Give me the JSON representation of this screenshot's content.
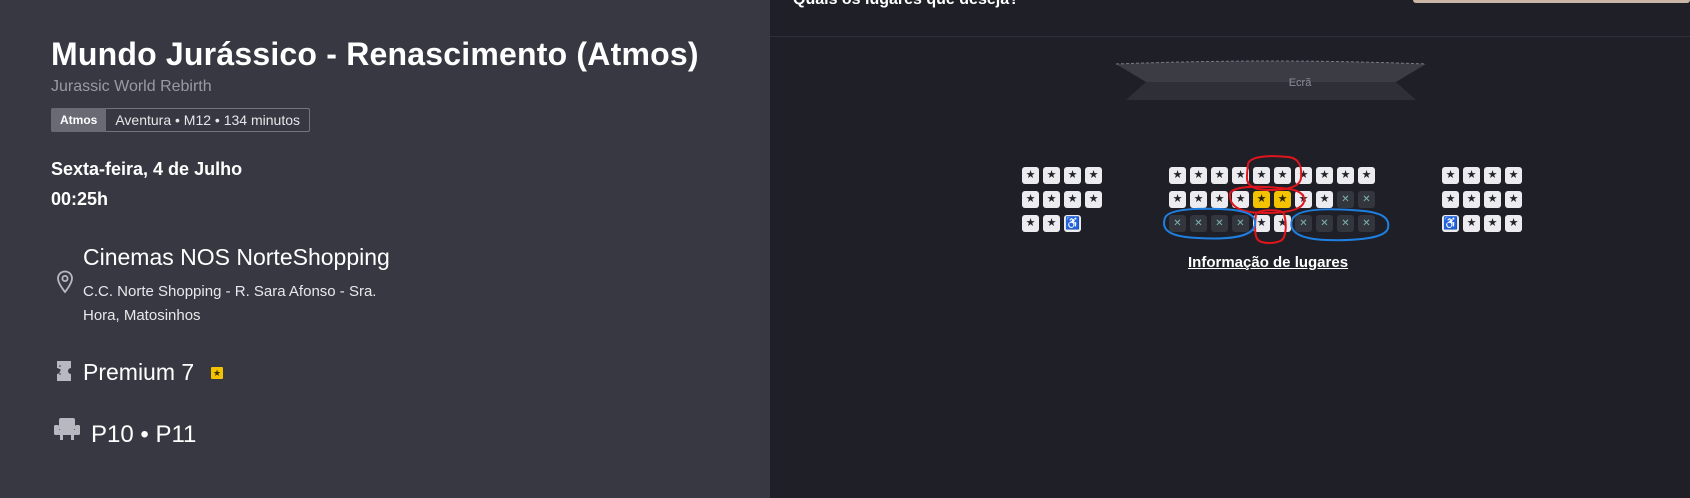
{
  "movie": {
    "title": "Mundo Jurássico - Renascimento (Atmos)",
    "original_title": "Jurassic World Rebirth",
    "format_tag": "Atmos",
    "info": "Aventura • M12 • 134 minutos"
  },
  "session": {
    "date": "Sexta-feira, 4 de Julho",
    "time": "00:25h"
  },
  "cinema": {
    "name": "Cinemas NOS NorteShopping",
    "address": "C.C. Norte Shopping - R. Sara Afonso - Sra. Hora, Matosinhos",
    "pin_icon": "location-pin-icon"
  },
  "room": {
    "name": "Premium 7",
    "badge_icon": "star-badge-icon",
    "ticket_icon": "ticket-icon"
  },
  "selected_seats": {
    "label": "P10 • P11",
    "icon": "seat-icon"
  },
  "seat_picker": {
    "question": "Quais os lugares que deseja?",
    "screen_label": "Ecrã",
    "info_link": "Informação de lugares",
    "legend_symbols": {
      "available": "★",
      "occupied": "✕",
      "wheelchair": "♿"
    },
    "colors": {
      "available": "#ececf0",
      "selected": "#f3c300",
      "occupied": "#33363d",
      "annotation_red": "#e0151b",
      "annotation_blue": "#1e7fe0"
    },
    "blocks": [
      {
        "name": "left",
        "rows": [
          [
            "avail",
            "avail",
            "avail",
            "avail"
          ],
          [
            "avail",
            "avail",
            "avail",
            "avail"
          ],
          [
            "avail",
            "avail",
            "wc"
          ]
        ]
      },
      {
        "name": "center",
        "rows": [
          [
            "avail",
            "avail",
            "avail",
            "avail",
            "avail",
            "avail",
            "avail",
            "avail",
            "avail",
            "avail"
          ],
          [
            "avail",
            "avail",
            "avail",
            "avail",
            "sel",
            "sel",
            "avail",
            "avail",
            "occ",
            "occ"
          ],
          [
            "occ",
            "occ",
            "occ",
            "occ",
            "avail",
            "avail",
            "occ",
            "occ",
            "occ",
            "occ"
          ]
        ]
      },
      {
        "name": "right",
        "rows": [
          [
            "avail",
            "avail",
            "avail",
            "avail"
          ],
          [
            "avail",
            "avail",
            "avail",
            "avail"
          ],
          [
            "wc",
            "avail",
            "avail",
            "avail"
          ]
        ]
      }
    ]
  }
}
